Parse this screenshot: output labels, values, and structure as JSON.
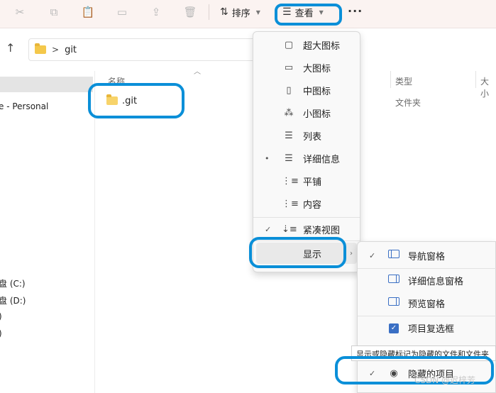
{
  "toolbar": {
    "sort_label": "排序",
    "view_label": "查看",
    "more_label": "···"
  },
  "address": {
    "crumb": "git",
    "separator": ">"
  },
  "nav": {
    "items": [
      "e - Personal",
      "盘 (C:)",
      "盘 (D:)",
      ")",
      ")"
    ]
  },
  "columns": {
    "name": "名称",
    "type": "类型",
    "size": "大小"
  },
  "files": [
    {
      "name": ".git",
      "type": "文件夹"
    }
  ],
  "view_menu": {
    "items": [
      {
        "label": "超大图标",
        "icon": "extra-large-icons-icon",
        "glyph": "▢",
        "mark": ""
      },
      {
        "label": "大图标",
        "icon": "large-icons-icon",
        "glyph": "▭",
        "mark": ""
      },
      {
        "label": "中图标",
        "icon": "medium-icons-icon",
        "glyph": "▯",
        "mark": ""
      },
      {
        "label": "小图标",
        "icon": "small-icons-icon",
        "glyph": "⁂",
        "mark": ""
      },
      {
        "label": "列表",
        "icon": "list-icon",
        "glyph": "☰",
        "mark": ""
      },
      {
        "label": "详细信息",
        "icon": "details-icon",
        "glyph": "☰",
        "mark": "•"
      },
      {
        "label": "平铺",
        "icon": "tiles-icon",
        "glyph": "⋮≡",
        "mark": ""
      },
      {
        "label": "内容",
        "icon": "content-icon",
        "glyph": "⋮≡",
        "mark": ""
      }
    ],
    "compact": {
      "label": "紧凑视图",
      "mark": "✓"
    },
    "show": {
      "label": "显示"
    }
  },
  "show_menu": {
    "items": [
      {
        "label": "导航窗格",
        "mark": "✓",
        "icon": "navigation-pane-icon"
      },
      {
        "label": "详细信息窗格",
        "mark": "",
        "icon": "details-pane-icon"
      },
      {
        "label": "预览窗格",
        "mark": "",
        "icon": "preview-pane-icon"
      },
      {
        "label": "项目复选框",
        "mark": "",
        "icon": "item-checkbox-icon"
      }
    ],
    "hidden": {
      "label": "隐藏的项目",
      "mark": "✓"
    },
    "tooltip": "显示或隐藏标记为隐藏的文件和文件夹"
  },
  "watermark": "CSDN @迟梓芳",
  "colors": {
    "toolbar_bg": "#fbf3f1",
    "annotation": "#0a8fd8",
    "folder": "#f4c84b",
    "accent": "#3a6fc4"
  }
}
